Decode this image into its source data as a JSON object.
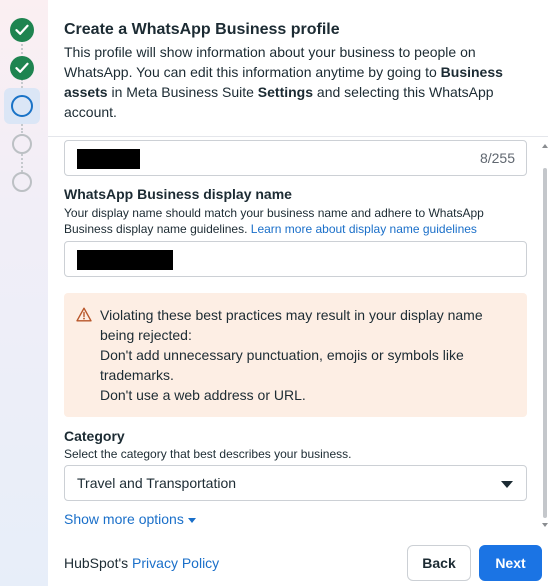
{
  "stepper": {
    "steps": [
      {
        "state": "done"
      },
      {
        "state": "done"
      },
      {
        "state": "current"
      },
      {
        "state": "todo"
      },
      {
        "state": "todo"
      }
    ]
  },
  "header": {
    "title": "Create a WhatsApp Business profile",
    "desc_1": "This profile will show information about your business to people on WhatsApp. You can edit this information anytime by going to ",
    "desc_bold_1": "Business assets",
    "desc_2": " in Meta Business Suite ",
    "desc_bold_2": "Settings",
    "desc_3": " and selecting this WhatsApp account."
  },
  "business_name_field": {
    "char_count": "8/255"
  },
  "display_name": {
    "label": "WhatsApp Business display name",
    "helper": "Your display name should match your business name and adhere to WhatsApp Business display name guidelines. ",
    "helper_link": "Learn more about display name guidelines"
  },
  "warning": {
    "line_1": "Violating these best practices may result in your display name being rejected:",
    "line_2": "Don't add unnecessary punctuation, emojis or symbols like trademarks.",
    "line_3": "Don't use a web address or URL."
  },
  "category": {
    "label": "Category",
    "helper": "Select the category that best describes your business.",
    "selected": "Travel and Transportation"
  },
  "more_options": "Show more options",
  "footer": {
    "privacy_prefix": "HubSpot's ",
    "privacy_link": "Privacy Policy",
    "back_label": "Back",
    "next_label": "Next"
  },
  "colors": {
    "done_step": "#1e8450",
    "current_step": "#1a73c7",
    "primary_button": "#1b74e4",
    "link": "#1a6fc9",
    "warning_bg": "#fdeee4"
  }
}
